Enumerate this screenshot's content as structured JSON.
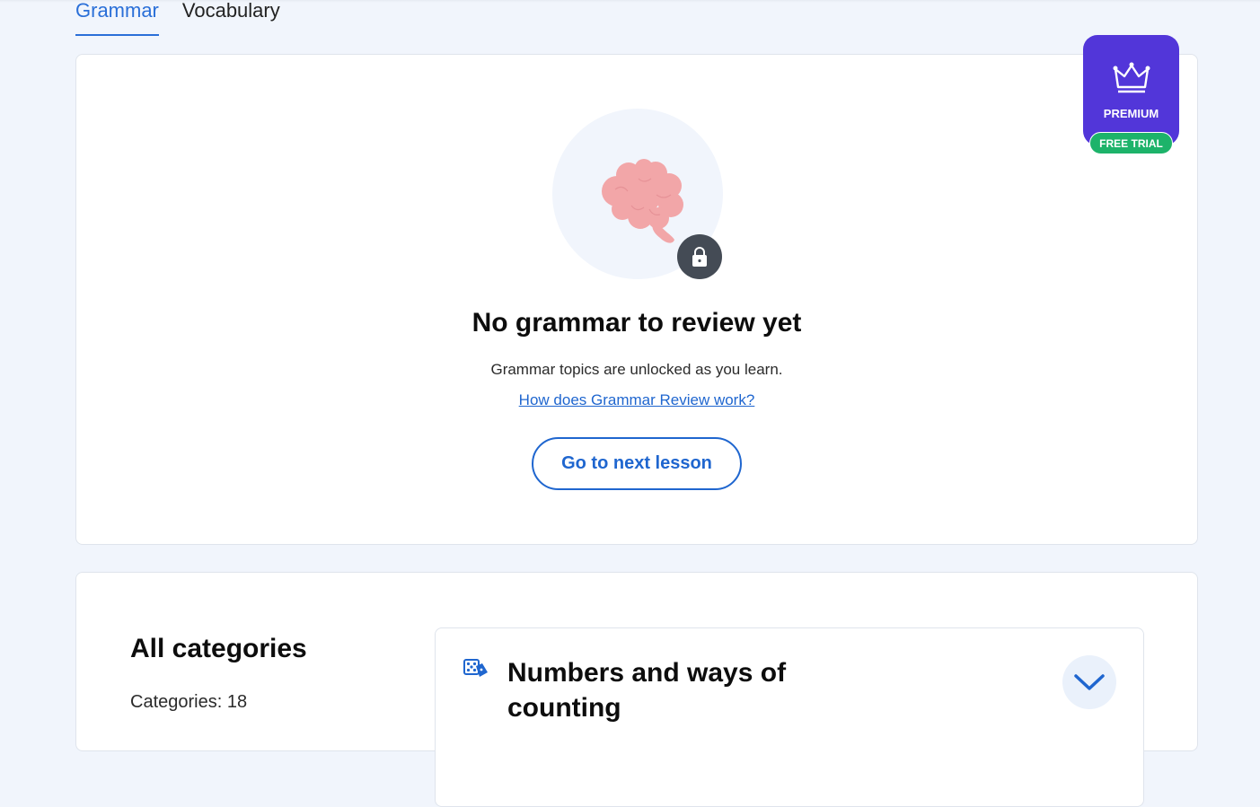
{
  "tabs": [
    {
      "label": "Grammar",
      "active": true
    },
    {
      "label": "Vocabulary",
      "active": false
    }
  ],
  "premium": {
    "label": "PREMIUM",
    "trial_label": "FREE TRIAL",
    "bg_color": "#5236d9",
    "trial_color": "#1db36a",
    "icon": "crown-icon"
  },
  "empty_state": {
    "illustration": "brain-icon",
    "badge_icon": "lock-icon",
    "title": "No grammar to review yet",
    "subtitle": "Grammar topics are unlocked as you learn.",
    "help_link": "How does Grammar Review work?",
    "cta_label": "Go to next lesson"
  },
  "categories": {
    "title": "All categories",
    "count_text": "Categories: 18",
    "items": [
      {
        "title": "Numbers and ways of counting",
        "icon": "dice-icon",
        "toggle_icon": "chevron-down-icon"
      }
    ]
  },
  "colors": {
    "accent": "#1f66cf",
    "background": "#f1f5fc"
  }
}
